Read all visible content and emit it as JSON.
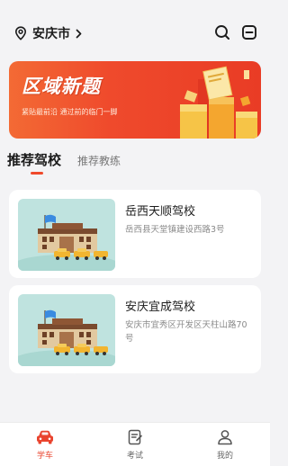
{
  "header": {
    "city": "安庆市",
    "icons": [
      "location-pin-icon",
      "chevron-right-icon",
      "search-icon",
      "scan-icon"
    ]
  },
  "banner": {
    "title": "区域新题",
    "subtitle": "紧贴最前沿  通过前的临门一脚",
    "colors": {
      "start": "#f36a34",
      "end": "#e93c25"
    }
  },
  "tabs": [
    {
      "label": "推荐驾校",
      "active": true
    },
    {
      "label": "推荐教练",
      "active": false
    }
  ],
  "schools": [
    {
      "name": "岳西天顺驾校",
      "address": "岳西县天堂镇建设西路3号"
    },
    {
      "name": "安庆宜成驾校",
      "address": "安庆市宜秀区开发区天柱山路70号"
    }
  ],
  "bottom_nav": [
    {
      "label": "学车",
      "icon": "car-icon",
      "active": true
    },
    {
      "label": "考试",
      "icon": "exam-icon",
      "active": false
    },
    {
      "label": "我的",
      "icon": "user-icon",
      "active": false
    }
  ],
  "colors": {
    "accent": "#e9432d",
    "background": "#f3f3f5",
    "thumb_bg": "#bfe3df"
  }
}
